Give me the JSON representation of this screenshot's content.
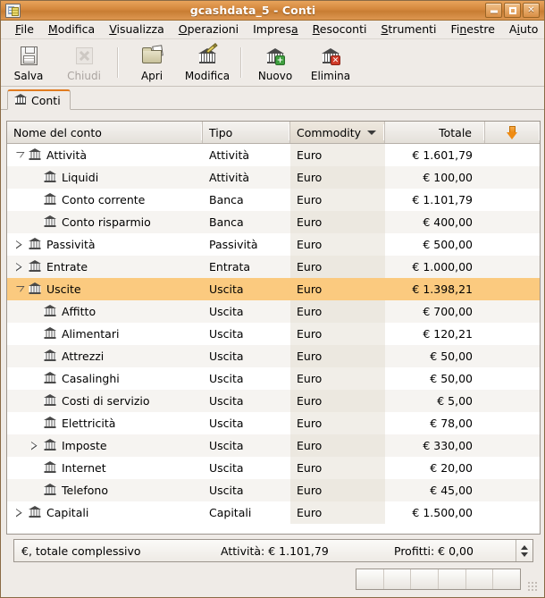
{
  "window": {
    "title": "gcashdata_5 - Conti",
    "icon": "gnucash-document-icon",
    "buttons": {
      "minimize": "minimize-icon",
      "maximize": "maximize-icon",
      "close": "✕"
    }
  },
  "menubar": {
    "items": [
      {
        "label": "File",
        "mnemonic_index": 0
      },
      {
        "label": "Modifica",
        "mnemonic_index": 0
      },
      {
        "label": "Visualizza",
        "mnemonic_index": 0
      },
      {
        "label": "Operazioni",
        "mnemonic_index": 0
      },
      {
        "label": "Impresa",
        "mnemonic_index": 6
      },
      {
        "label": "Resoconti",
        "mnemonic_index": 0
      },
      {
        "label": "Strumenti",
        "mnemonic_index": 0
      },
      {
        "label": "Finestre",
        "mnemonic_index": 2
      },
      {
        "label": "Aiuto",
        "mnemonic_index": 1
      }
    ]
  },
  "toolbar": {
    "buttons": [
      {
        "label": "Salva",
        "icon": "floppy-disk-icon",
        "enabled": true
      },
      {
        "label": "Chiudi",
        "icon": "close-x-icon",
        "enabled": false
      },
      {
        "label": "Apri",
        "icon": "open-folder-icon",
        "enabled": true
      },
      {
        "label": "Modifica",
        "icon": "edit-account-icon",
        "enabled": true
      },
      {
        "label": "Nuovo",
        "icon": "new-account-icon",
        "enabled": true
      },
      {
        "label": "Elimina",
        "icon": "delete-account-icon",
        "enabled": true
      }
    ]
  },
  "tabs": [
    {
      "label": "Conti",
      "icon": "bank-icon",
      "active": true
    }
  ],
  "tree": {
    "columns": [
      {
        "key": "name",
        "label": "Nome del conto",
        "align": "left"
      },
      {
        "key": "type",
        "label": "Tipo",
        "align": "left"
      },
      {
        "key": "commodity",
        "label": "Commodity",
        "align": "left",
        "sorted": true,
        "sort_caret": "▼"
      },
      {
        "key": "total",
        "label": "Totale",
        "align": "right"
      },
      {
        "key": "options",
        "label": "",
        "icon": "orange-down-arrow-icon"
      }
    ],
    "rows": [
      {
        "name": "Attività",
        "type": "Attività",
        "commodity": "Euro",
        "total": "€ 1.601,79",
        "depth": 0,
        "expander": "open",
        "selected": false
      },
      {
        "name": "Liquidi",
        "type": "Attività",
        "commodity": "Euro",
        "total": "€ 100,00",
        "depth": 1,
        "expander": "none",
        "selected": false
      },
      {
        "name": "Conto corrente",
        "type": "Banca",
        "commodity": "Euro",
        "total": "€ 1.101,79",
        "depth": 1,
        "expander": "none",
        "selected": false
      },
      {
        "name": "Conto risparmio",
        "type": "Banca",
        "commodity": "Euro",
        "total": "€ 400,00",
        "depth": 1,
        "expander": "none",
        "selected": false
      },
      {
        "name": "Passività",
        "type": "Passività",
        "commodity": "Euro",
        "total": "€ 500,00",
        "depth": 0,
        "expander": "closed",
        "selected": false
      },
      {
        "name": "Entrate",
        "type": "Entrata",
        "commodity": "Euro",
        "total": "€ 1.000,00",
        "depth": 0,
        "expander": "closed",
        "selected": false
      },
      {
        "name": "Uscite",
        "type": "Uscita",
        "commodity": "Euro",
        "total": "€ 1.398,21",
        "depth": 0,
        "expander": "open",
        "selected": true
      },
      {
        "name": "Affitto",
        "type": "Uscita",
        "commodity": "Euro",
        "total": "€ 700,00",
        "depth": 1,
        "expander": "none",
        "selected": false
      },
      {
        "name": "Alimentari",
        "type": "Uscita",
        "commodity": "Euro",
        "total": "€ 120,21",
        "depth": 1,
        "expander": "none",
        "selected": false
      },
      {
        "name": "Attrezzi",
        "type": "Uscita",
        "commodity": "Euro",
        "total": "€ 50,00",
        "depth": 1,
        "expander": "none",
        "selected": false
      },
      {
        "name": "Casalinghi",
        "type": "Uscita",
        "commodity": "Euro",
        "total": "€ 50,00",
        "depth": 1,
        "expander": "none",
        "selected": false
      },
      {
        "name": "Costi di servizio",
        "type": "Uscita",
        "commodity": "Euro",
        "total": "€ 5,00",
        "depth": 1,
        "expander": "none",
        "selected": false
      },
      {
        "name": "Elettricità",
        "type": "Uscita",
        "commodity": "Euro",
        "total": "€ 78,00",
        "depth": 1,
        "expander": "none",
        "selected": false
      },
      {
        "name": "Imposte",
        "type": "Uscita",
        "commodity": "Euro",
        "total": "€ 330,00",
        "depth": 1,
        "expander": "closed",
        "selected": false
      },
      {
        "name": "Internet",
        "type": "Uscita",
        "commodity": "Euro",
        "total": "€ 20,00",
        "depth": 1,
        "expander": "none",
        "selected": false
      },
      {
        "name": "Telefono",
        "type": "Uscita",
        "commodity": "Euro",
        "total": "€ 45,00",
        "depth": 1,
        "expander": "none",
        "selected": false
      },
      {
        "name": "Capitali",
        "type": "Capitali",
        "commodity": "Euro",
        "total": "€ 1.500,00",
        "depth": 0,
        "expander": "closed",
        "selected": false
      }
    ]
  },
  "summary": {
    "currency_label": "€, totale complessivo",
    "assets": "Attività: € 1.101,79",
    "profits": "Profitti: € 0,00",
    "spinner": "up-down-spinner"
  },
  "statusbar": {
    "progress_segments": 6,
    "grip": "resize-grip-icon"
  },
  "colors": {
    "titlebar": "#d4873c",
    "selection": "#fbca7f",
    "tab_accent": "#e07b1f",
    "sort_column": "#ded6c8"
  }
}
